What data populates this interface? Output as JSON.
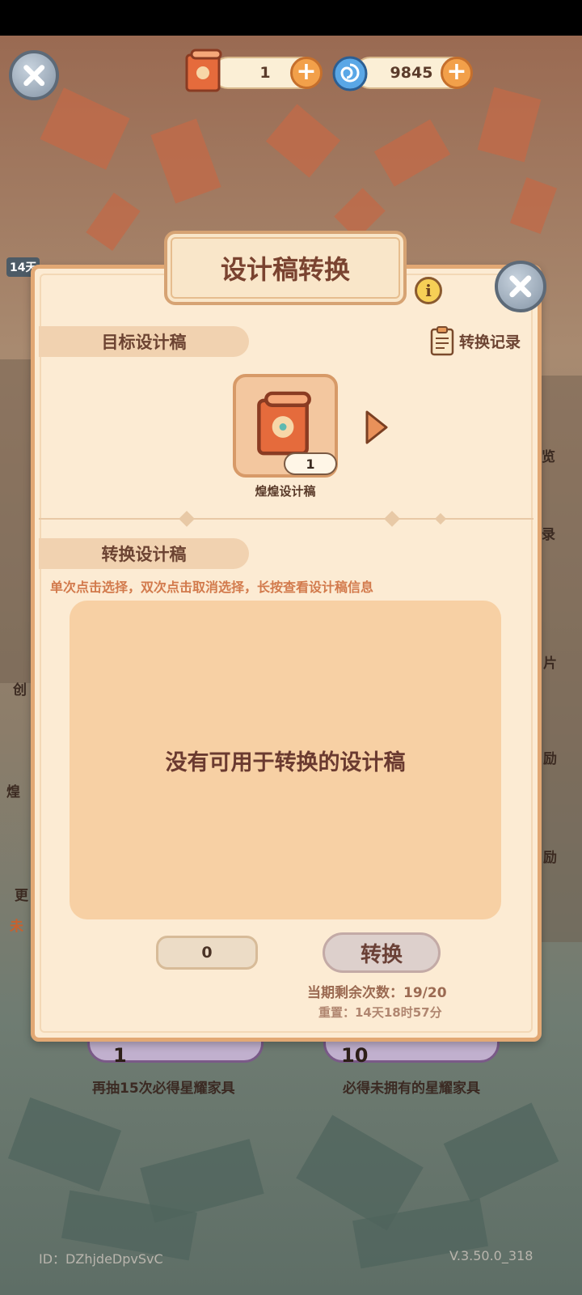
{
  "top_bar": {
    "design_paper_count": "1",
    "gem_count": "9845"
  },
  "dialog": {
    "title": "设计稿转换",
    "info_glyph": "i",
    "target_label": "目标设计稿",
    "record_label": "转换记录",
    "target_item": {
      "name": "煌煌设计稿",
      "count": "1"
    },
    "convert_label": "转换设计稿",
    "hint": "单次点击选择，双次点击取消选择，长按查看设计稿信息",
    "empty_message": "没有可用于转换的设计稿",
    "selected_quantity": "0",
    "convert_button": "转换",
    "remaining": "当期剩余次数：19/20",
    "reset": "重置：14天18时57分"
  },
  "background": {
    "left_badge": "14天",
    "right_text_1": "览",
    "right_text_2": "录",
    "right_text_3": "片",
    "right_text_4": "励",
    "right_text_5": "励",
    "left_text_1": "创",
    "left_text_2": "煌",
    "left_text_3": "更",
    "left_text_4": "未",
    "pull_single_num": "1",
    "pull_single_caption": "再抽15次必得星耀家具",
    "pull_ten_num": "10",
    "pull_ten_caption": "必得未拥有的星耀家具"
  },
  "footer": {
    "user_id": "ID：DZhjdeDpvSvC",
    "version": "V.3.50.0_318"
  },
  "icons": [
    "close-icon",
    "design-scroll-icon",
    "plus-icon",
    "gem-swirl-icon",
    "info-icon",
    "clipboard-icon",
    "arrow-right-icon"
  ],
  "colors": {
    "accent_orange": "#f2a04a",
    "dialog_bg": "#fcebd3",
    "dialog_border": "#e2a874",
    "title_text": "#7a4330",
    "hint_text": "#d27a4c",
    "empty_area": "#f7d0a4"
  }
}
